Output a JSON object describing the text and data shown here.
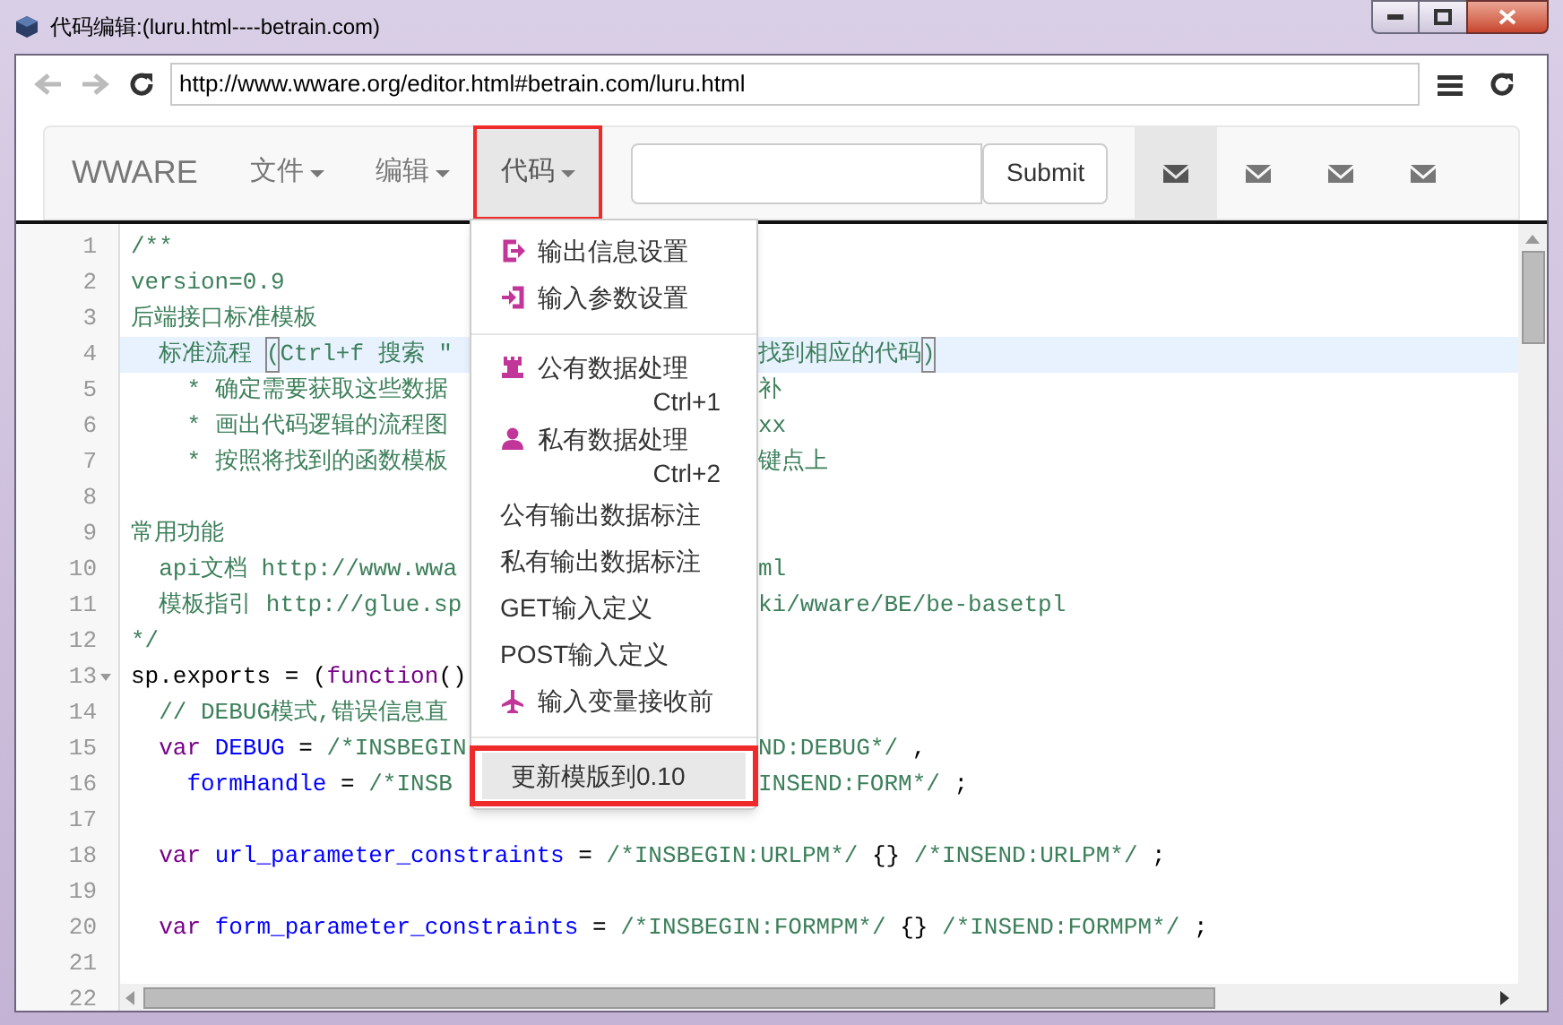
{
  "window": {
    "title": "代码编辑:(luru.html----betrain.com)"
  },
  "browser": {
    "nav_buttons": [
      {
        "kind": "back",
        "disabled": true
      },
      {
        "kind": "forward",
        "disabled": true
      },
      {
        "kind": "reload",
        "disabled": false
      }
    ],
    "url": "http://www.wware.org/editor.html#betrain.com/luru.html"
  },
  "navbar": {
    "brand": "WWARE",
    "menus": [
      {
        "label": "文件",
        "selected": false,
        "outlined": false
      },
      {
        "label": "编辑",
        "selected": false,
        "outlined": false
      },
      {
        "label": "代码",
        "selected": true,
        "outlined": true
      }
    ],
    "submit": "Submit",
    "mail_tabs": [
      {
        "selected": true
      },
      {
        "selected": false
      },
      {
        "selected": false
      },
      {
        "selected": false
      }
    ]
  },
  "editor": {
    "lines": [
      {
        "number": "1",
        "active": false,
        "foldable": false,
        "left": [
          {
            "kind": "comment",
            "text": "/**"
          }
        ]
      },
      {
        "number": "2",
        "active": false,
        "foldable": false,
        "left": [
          {
            "kind": "comment",
            "text": "version=0.9"
          }
        ]
      },
      {
        "number": "3",
        "active": false,
        "foldable": false,
        "left": [
          {
            "kind": "comment",
            "text": "后端接口标准模板"
          }
        ]
      },
      {
        "number": "4",
        "active": true,
        "foldable": false,
        "left": [
          {
            "kind": "comment",
            "text": "  标准流程 "
          },
          {
            "kind": "bracket",
            "text": "("
          },
          {
            "kind": "comment",
            "text": "Ctrl+f 搜索 \""
          }
        ],
        "right": [
          {
            "kind": "comment",
            "text": "找到相应的代码"
          },
          {
            "kind": "bracket",
            "text": ")"
          }
        ]
      },
      {
        "number": "5",
        "active": false,
        "foldable": false,
        "left": [
          {
            "kind": "comment",
            "text": "    * 确定需要获取这些数据"
          }
        ],
        "right": [
          {
            "kind": "comment",
            "text": "补"
          }
        ]
      },
      {
        "number": "6",
        "active": false,
        "foldable": false,
        "left": [
          {
            "kind": "comment",
            "text": "    * 画出代码逻辑的流程图"
          }
        ],
        "right": [
          {
            "kind": "comment",
            "text": "xx"
          }
        ]
      },
      {
        "number": "7",
        "active": false,
        "foldable": false,
        "left": [
          {
            "kind": "comment",
            "text": "    * 按照将找到的函数模板"
          }
        ],
        "right": [
          {
            "kind": "comment",
            "text": "键点上"
          }
        ]
      },
      {
        "number": "8",
        "active": false,
        "foldable": false
      },
      {
        "number": "9",
        "active": false,
        "foldable": false,
        "left": [
          {
            "kind": "comment",
            "text": "常用功能"
          }
        ]
      },
      {
        "number": "10",
        "active": false,
        "foldable": false,
        "left": [
          {
            "kind": "comment",
            "text": "  api文档 http://www.wwa"
          }
        ],
        "right": [
          {
            "kind": "comment",
            "text": "ml"
          }
        ]
      },
      {
        "number": "11",
        "active": false,
        "foldable": false,
        "left": [
          {
            "kind": "comment",
            "text": "  模板指引 http://glue.sp"
          }
        ],
        "right": [
          {
            "kind": "comment",
            "text": "ki/wware/BE/be-basetpl"
          }
        ]
      },
      {
        "number": "12",
        "active": false,
        "foldable": false,
        "left": [
          {
            "kind": "comment",
            "text": "*/"
          }
        ]
      },
      {
        "number": "13",
        "active": false,
        "foldable": true,
        "left": [
          {
            "kind": "plain",
            "text": "sp.exports = ("
          },
          {
            "kind": "keyword",
            "text": "function"
          },
          {
            "kind": "plain",
            "text": "()"
          }
        ]
      },
      {
        "number": "14",
        "active": false,
        "foldable": false,
        "left": [
          {
            "kind": "comment",
            "text": "  // DEBUG模式,错误信息直"
          }
        ]
      },
      {
        "number": "15",
        "active": false,
        "foldable": false,
        "left": [
          {
            "kind": "keyword",
            "text": "  var"
          },
          {
            "kind": "variable",
            "text": " DEBUG"
          },
          {
            "kind": "plain",
            "text": " = "
          },
          {
            "kind": "comment",
            "text": "/*INSBEGIN"
          }
        ],
        "right": [
          {
            "kind": "comment",
            "text": "ND:DEBUG*/"
          },
          {
            "kind": "plain",
            "text": " ,"
          }
        ]
      },
      {
        "number": "16",
        "active": false,
        "foldable": false,
        "left": [
          {
            "kind": "variable",
            "text": "    formHandle"
          },
          {
            "kind": "plain",
            "text": " = "
          },
          {
            "kind": "comment",
            "text": "/*INSB"
          }
        ],
        "right": [
          {
            "kind": "comment",
            "text": "INSEND:FORM*/"
          },
          {
            "kind": "plain",
            "text": " ;"
          }
        ]
      },
      {
        "number": "17",
        "active": false,
        "foldable": false
      },
      {
        "number": "18",
        "active": false,
        "foldable": false,
        "left": [
          {
            "kind": "keyword",
            "text": "  var"
          },
          {
            "kind": "variable",
            "text": " url_parameter_constraints"
          },
          {
            "kind": "plain",
            "text": " = "
          },
          {
            "kind": "comment",
            "text": "/*INSBEGIN:URLPM*/"
          },
          {
            "kind": "plain",
            "text": " {} "
          },
          {
            "kind": "comment",
            "text": "/*INSEND:URLPM*/"
          },
          {
            "kind": "plain",
            "text": " ;"
          }
        ]
      },
      {
        "number": "19",
        "active": false,
        "foldable": false
      },
      {
        "number": "20",
        "active": false,
        "foldable": false,
        "left": [
          {
            "kind": "keyword",
            "text": "  var"
          },
          {
            "kind": "variable",
            "text": " form_parameter_constraints"
          },
          {
            "kind": "plain",
            "text": " = "
          },
          {
            "kind": "comment",
            "text": "/*INSBEGIN:FORMPM*/"
          },
          {
            "kind": "plain",
            "text": " {} "
          },
          {
            "kind": "comment",
            "text": "/*INSEND:FORMPM*/"
          },
          {
            "kind": "plain",
            "text": " ;"
          }
        ]
      },
      {
        "number": "21",
        "active": false,
        "foldable": false
      },
      {
        "number": "22",
        "active": false,
        "foldable": false
      }
    ]
  },
  "code_menu": {
    "items": [
      {
        "kind": "exit",
        "label": "输出信息设置",
        "selected": false,
        "outlined": false
      },
      {
        "kind": "enter",
        "label": "输入参数设置",
        "selected": false,
        "outlined": false
      },
      {
        "kind": "divider"
      },
      {
        "kind": "tower",
        "label": "公有数据处理",
        "shortcut": "Ctrl+1",
        "selected": false,
        "outlined": false
      },
      {
        "kind": "person",
        "label": "私有数据处理",
        "shortcut": "Ctrl+2",
        "selected": false,
        "outlined": false
      },
      {
        "kind": "text",
        "label": "公有输出数据标注",
        "selected": false,
        "outlined": false
      },
      {
        "kind": "text",
        "label": "私有输出数据标注",
        "selected": false,
        "outlined": false
      },
      {
        "kind": "text",
        "label": "GET输入定义",
        "selected": false,
        "outlined": false
      },
      {
        "kind": "text",
        "label": "POST输入定义",
        "selected": false,
        "outlined": false
      },
      {
        "kind": "plane",
        "label": "输入变量接收前",
        "selected": false,
        "outlined": false
      },
      {
        "kind": "divider"
      },
      {
        "kind": "text",
        "label": "更新模版到0.10",
        "selected": true,
        "outlined": true
      }
    ]
  }
}
